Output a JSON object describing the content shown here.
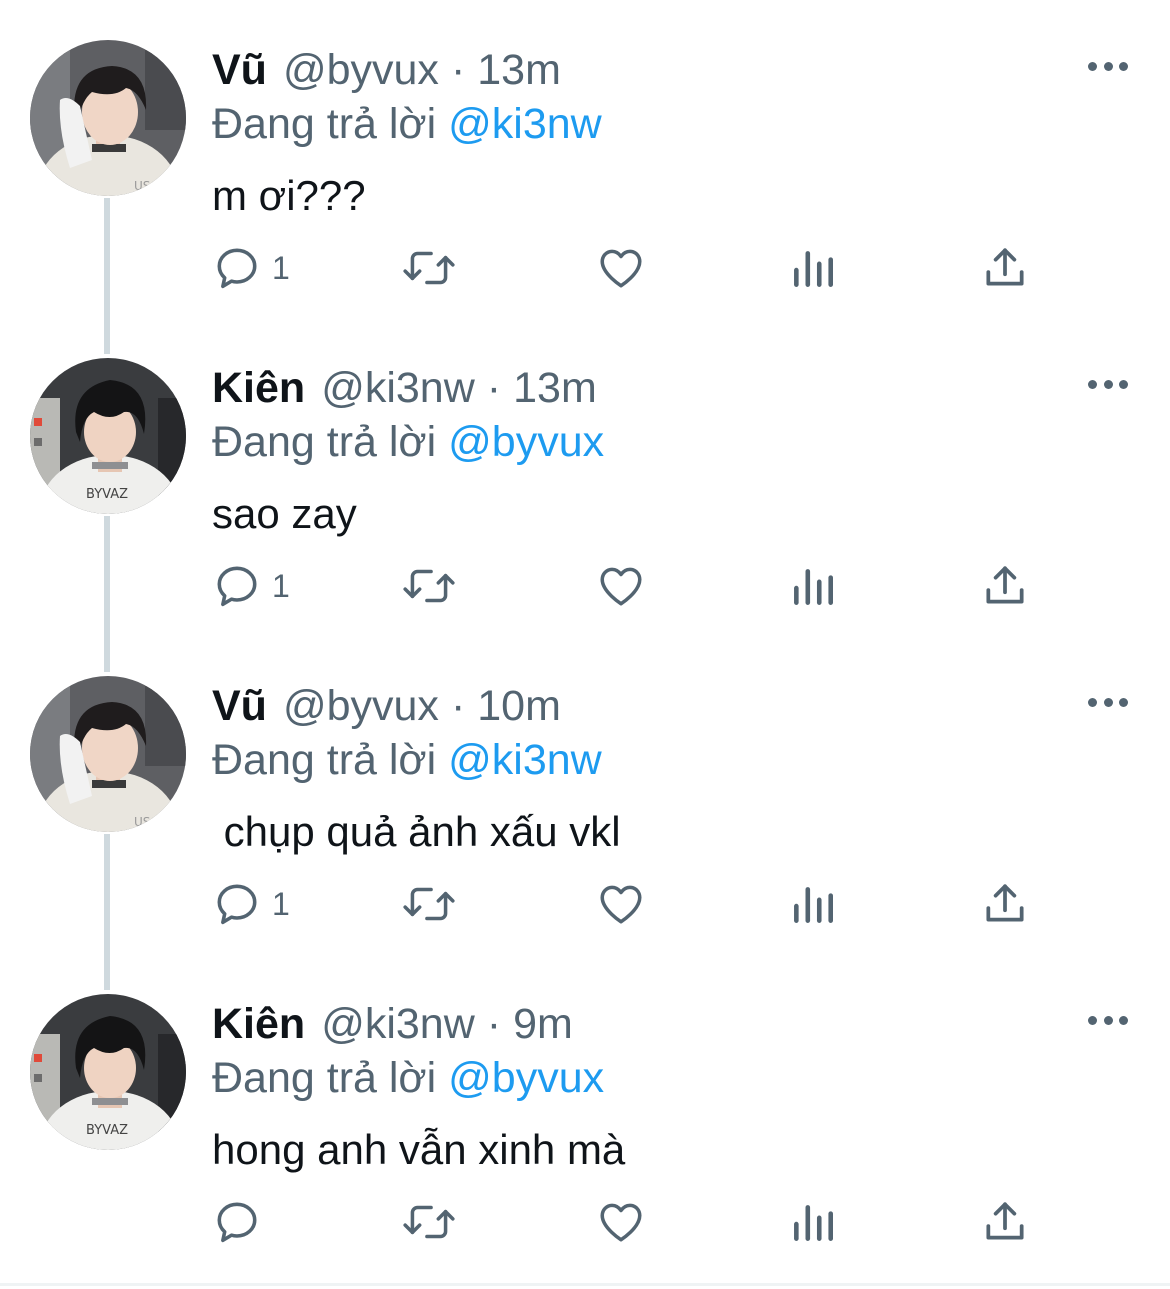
{
  "colors": {
    "text": "#0f1419",
    "secondary": "#536471",
    "link": "#1d9bf0",
    "thread_line": "#cfd9de"
  },
  "tweets": [
    {
      "name": "Vũ",
      "handle": "@byvux",
      "separator": "·",
      "time": "13m",
      "replying_prefix": "Đang trả lời",
      "replying_to": "@ki3nw",
      "text": "m ơi???",
      "reply_count": "1",
      "avatar": "vu-avatar"
    },
    {
      "name": "Kiên",
      "handle": "@ki3nw",
      "separator": "·",
      "time": "13m",
      "replying_prefix": "Đang trả lời",
      "replying_to": "@byvux",
      "text": "sao zay",
      "reply_count": "1",
      "avatar": "kien-avatar"
    },
    {
      "name": "Vũ",
      "handle": "@byvux",
      "separator": "·",
      "time": "10m",
      "replying_prefix": "Đang trả lời",
      "replying_to": "@ki3nw",
      "text": " chụp quả ảnh xấu vkl",
      "reply_count": "1",
      "avatar": "vu-avatar"
    },
    {
      "name": "Kiên",
      "handle": "@ki3nw",
      "separator": "·",
      "time": "9m",
      "replying_prefix": "Đang trả lời",
      "replying_to": "@byvux",
      "text": "hong anh vẫn xinh mà",
      "reply_count": "",
      "avatar": "kien-avatar"
    }
  ],
  "icons": {
    "reply": "reply-icon",
    "retweet": "retweet-icon",
    "like": "heart-icon",
    "views": "views-icon",
    "share": "share-icon",
    "more": "more-icon"
  }
}
